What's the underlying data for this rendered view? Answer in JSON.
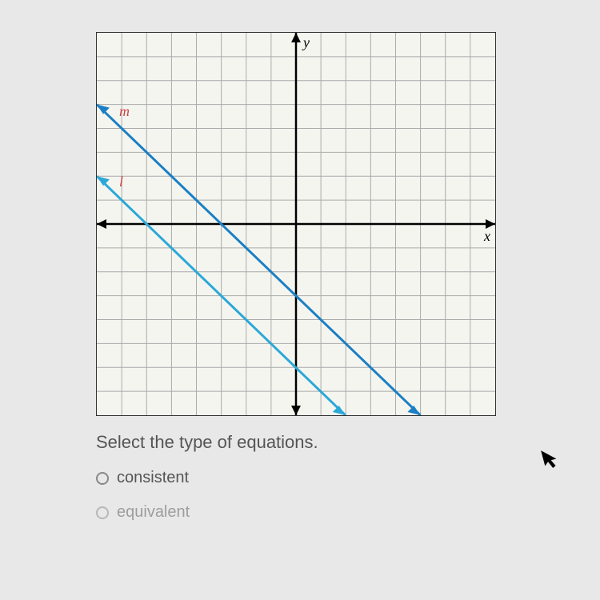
{
  "chart_data": {
    "type": "line",
    "title": "",
    "xlabel": "x",
    "ylabel": "y",
    "xlim": [
      -8,
      8
    ],
    "ylim": [
      -8,
      8
    ],
    "grid": true,
    "series": [
      {
        "name": "m",
        "slope": -1,
        "y_intercept": -3,
        "color": "#1a7fc4"
      },
      {
        "name": "l",
        "slope": -1,
        "y_intercept": -6,
        "color": "#2aa8d8"
      }
    ]
  },
  "axes": {
    "x_label": "x",
    "y_label": "y"
  },
  "line_labels": {
    "m": "m",
    "l": "l"
  },
  "question": "Select the type of equations.",
  "options": [
    "consistent",
    "equivalent"
  ]
}
